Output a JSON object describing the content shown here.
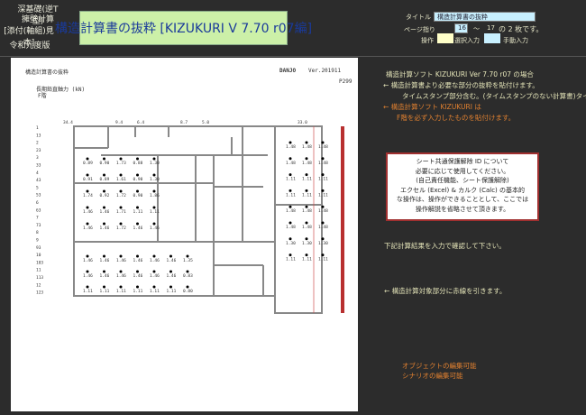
{
  "header": {
    "line1": "深基礎(逆T型)",
    "line2": "擁壁計算",
    "line3": "[添付(軸組)見本]",
    "edition": "令和元度版",
    "title": "構造計算書の抜粋 [KIZUKURI V 7.70 r07編]"
  },
  "form": {
    "title_label": "タイトル",
    "title_value": "構造計算書の抜粋",
    "page_label": "ページ指り",
    "page_from": "16",
    "tilde": "～",
    "page_to": "17",
    "page_of": "の 2 枚です。",
    "op_label": "操作",
    "select_label": "選択入力",
    "manual_label": "手動入力"
  },
  "doc": {
    "heading": "構造計算書の抜粋",
    "company": "DANJO",
    "version": "Ver.201911",
    "page_no": "P299",
    "subtitle": "長期鉛直軸力 (kN)",
    "floor": "F階",
    "row_labels": [
      "1",
      "13",
      "2",
      "23",
      "3",
      "33",
      "4",
      "43",
      "5",
      "53",
      "6",
      "63",
      "7",
      "73",
      "8",
      "9",
      "93",
      "10",
      "103",
      "11",
      "113",
      "12",
      "123"
    ],
    "top_values": [
      "34.4",
      "9.4",
      "6.4",
      "8.7",
      "5.0",
      "33.0"
    ],
    "left_values": [
      [
        "0.89",
        "0.90",
        "1.73",
        "0.88",
        "1.30"
      ],
      [
        "0.91",
        "0.89",
        "1.61",
        "0.90",
        "1.30"
      ],
      [
        "1.74",
        "0.92",
        "1.72",
        "0.90",
        "1.86"
      ],
      [
        "1.46",
        "1.46",
        "1.71",
        "1.11",
        "1.11"
      ],
      [
        "1.46",
        "1.46",
        "1.72",
        "1.46",
        "1.46"
      ]
    ],
    "bottom_values": [
      [
        "1.46",
        "1.46",
        "1.46",
        "1.46",
        "1.46",
        "1.46",
        "1.35"
      ],
      [
        "1.46",
        "1.46",
        "1.46",
        "1.46",
        "1.46",
        "1.46",
        "0.83"
      ],
      [
        "1.11",
        "1.11",
        "1.11",
        "1.11",
        "1.11",
        "1.11",
        "0.80"
      ]
    ],
    "right_values": [
      [
        "1.48",
        "1.48",
        "1.48"
      ],
      [
        "1.48",
        "1.48",
        "1.48"
      ],
      [
        "1.11",
        "1.11",
        "1.11"
      ],
      [
        "1.11",
        "1.11",
        "1.11"
      ],
      [
        "1.48",
        "1.48",
        "1.48"
      ],
      [
        "1.48",
        "1.48",
        "1.48"
      ],
      [
        "1.30",
        "1.30",
        "1.30"
      ],
      [
        "1.11",
        "1.11",
        "1.11"
      ]
    ]
  },
  "right": {
    "line1": "構造計算ソフト KIZUKURI Ver 7.70 r07 の場合",
    "line2": "← 構造計算書より必要な部分の抜粋を貼付けます。",
    "line3": "タイムスタンプ部分含む。(タイムスタンプのない計算書)タイムスタ",
    "line4": "← 構造計算ソフト KIZUKURI は",
    "line5": "F階を必ず入力したものを貼付けます。",
    "note": [
      "シート共通保護解除 ID について",
      "必要に応じて使用してください。",
      "(自己責任機能、シート保護解除)",
      "エクセル (Excel) & カルク (Calc) の基本的",
      "な操作は、操作ができることとして、ここでは",
      "操作解説を省略させて頂きます。"
    ],
    "confirm": "下記計算結果を入力で確認して下さい。",
    "redline": "← 構造計算対象部分に赤線を引きます。",
    "obj_edit": "オブジェクトの編集可能",
    "scenario_edit": "シナリオの編集可能"
  },
  "colors": {
    "bg": "#2c2c2c",
    "title_bg": "#ccf0a8",
    "accent_red": "#b83030",
    "orange": "#e08030"
  }
}
